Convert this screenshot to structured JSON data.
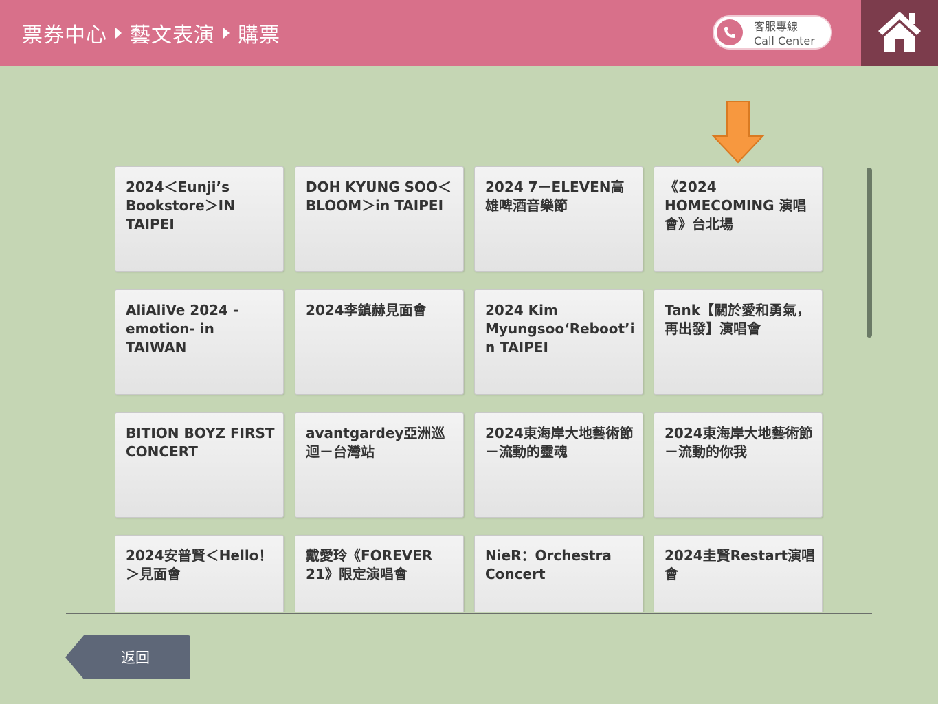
{
  "header": {
    "breadcrumb": [
      "票券中心",
      "藝文表演",
      "購票"
    ],
    "call_center": {
      "label_zh": "客服專線",
      "label_en": "Call Center"
    },
    "home_icon": "home-icon"
  },
  "events": [
    [
      "2024＜Eunji’s Bookstore＞IN TAIPEI",
      "DOH KYUNG SOO＜BLOOM＞in TAIPEI",
      "2024 7－ELEVEN高雄啤酒音樂節",
      "《2024 HOMECOMING 演唱會》台北場"
    ],
    [
      "AliAliVe 2024 -emotion- in TAIWAN",
      "2024李鎮赫見面會",
      "2024 Kim Myungsoo‘Reboot’in TAIPEI",
      "Tank【關於愛和勇氣，再出發】演唱會"
    ],
    [
      "BITION BOYZ FIRST CONCERT",
      "avantgardey亞洲巡迴－台灣站",
      "2024東海岸大地藝術節－流動的靈魂",
      "2024東海岸大地藝術節－流動的你我"
    ],
    [
      "2024安普賢＜Hello！＞見面會",
      "戴愛玲《FOREVER 21》限定演唱會",
      "NieR：Orchestra Concert",
      "2024圭賢Restart演唱會"
    ]
  ],
  "footer": {
    "back_label": "返回"
  },
  "colors": {
    "header": "#d8708a",
    "home": "#7c3c4c",
    "background": "#c5d6b4",
    "arrow": "#f7983f",
    "back": "#5e6778"
  }
}
